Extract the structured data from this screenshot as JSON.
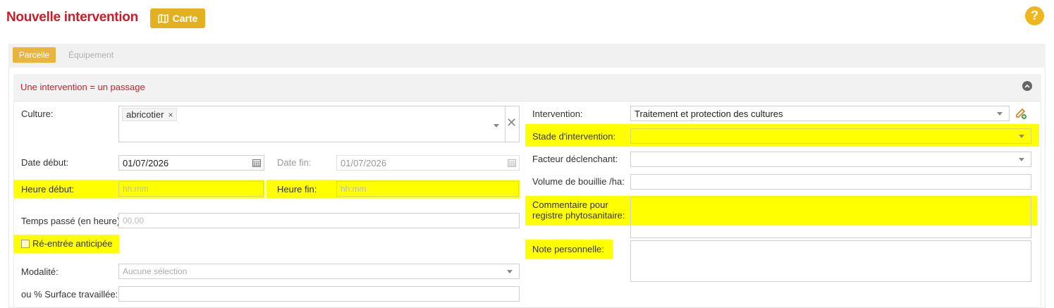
{
  "header": {
    "title": "Nouvelle intervention",
    "carte_label": "Carte",
    "help_label": "?"
  },
  "tabs": [
    {
      "label": "Parcelle",
      "active": true
    },
    {
      "label": "Équipement",
      "active": false
    }
  ],
  "panel": {
    "title": "Une intervention = un passage"
  },
  "form_left": {
    "culture_label": "Culture:",
    "culture_tag": "abricotier",
    "culture_tag_remove": "×",
    "culture_clear": "✕",
    "date_debut_label": "Date début:",
    "date_debut_value": "01/07/2026",
    "date_fin_label": "Date fin:",
    "date_fin_value": "01/07/2026",
    "heure_debut_label": "Heure début:",
    "heure_debut_placeholder": "hh:mm",
    "heure_fin_label": "Heure fin:",
    "heure_fin_placeholder": "hh:mm",
    "temps_label": "Temps passé (en heure):",
    "temps_placeholder": "00,00",
    "reentree_label": "Ré-entrée anticipée",
    "modalite_label": "Modalité:",
    "modalite_value": "Aucune sélection",
    "surface_label": "ou % Surface travaillée:"
  },
  "form_right": {
    "intervention_label": "Intervention:",
    "intervention_value": "Traitement et protection des cultures",
    "stade_label": "Stade d'intervention:",
    "facteur_label": "Facteur déclenchant:",
    "volume_label": "Volume de bouillie /ha:",
    "commentaire_label_1": "Commentaire pour",
    "commentaire_label_2": "registre phytosanitaire:",
    "note_label": "Note personnelle:"
  },
  "colors": {
    "title_red": "#c8202a",
    "accent_gold": "#e3b020",
    "highlight": "#ffff00"
  }
}
